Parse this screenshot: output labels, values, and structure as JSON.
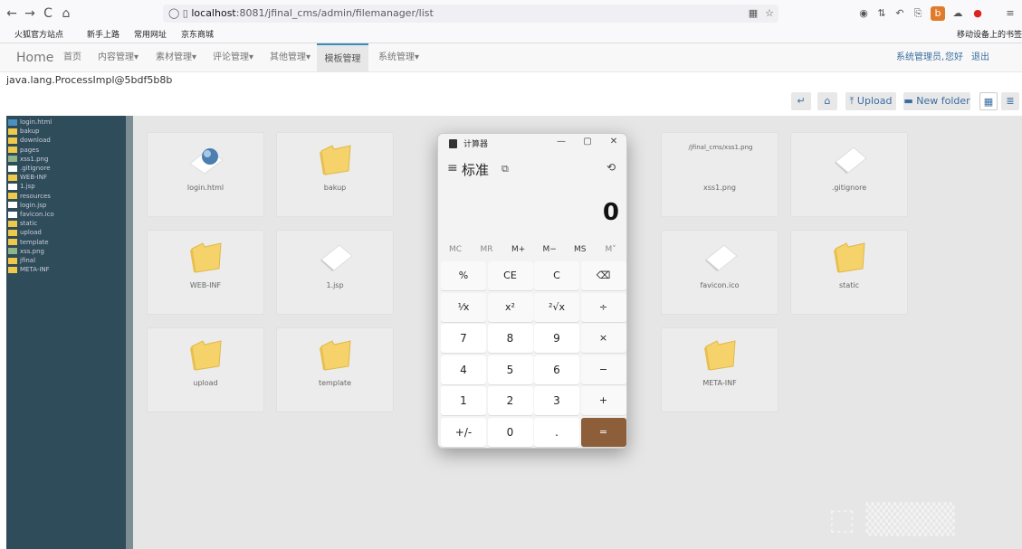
{
  "browser": {
    "back": "←",
    "forward": "→",
    "reload": "C",
    "home": "⌂",
    "url_host": "localhost",
    "url_rest": ":8081/jfinal_cms/admin/filemanager/list",
    "mobile_bookmarks": "移动设备上的书签"
  },
  "bookmarks": [
    "火狐官方站点",
    "新手上路",
    "常用网址",
    "京东商城"
  ],
  "nav": {
    "brand": "Home",
    "items": [
      "首页",
      "内容管理▾",
      "素材管理▾",
      "评论管理▾",
      "其他管理▾",
      "模板管理",
      "系统管理▾"
    ],
    "user": "系统管理员,",
    "greeting": "您好",
    "logout": "退出"
  },
  "process_text": "java.lang.ProcessImpl@5bdf5b8b",
  "toolbar": {
    "upload": "Upload",
    "new_folder": "New folder"
  },
  "tree": [
    "login.html",
    "bakup",
    "download",
    "pages",
    "xss1.png",
    ".gitignore",
    "WEB-INF",
    "1.jsp",
    "resources",
    "login.jsp",
    "favicon.ico",
    "static",
    "upload",
    "template",
    "xss.png",
    "jfinal",
    "META-INF"
  ],
  "tiles": [
    {
      "label": "login.html",
      "kind": "globe"
    },
    {
      "label": "bakup",
      "kind": "folder"
    },
    {
      "label": "xss1.png",
      "kind": "image",
      "caption": "/jfinal_cms/xss1.png"
    },
    {
      "label": ".gitignore",
      "kind": "file"
    },
    {
      "label": "WEB-INF",
      "kind": "folder"
    },
    {
      "label": "1.jsp",
      "kind": "file"
    },
    {
      "label": "favicon.ico",
      "kind": "file"
    },
    {
      "label": "static",
      "kind": "folder"
    },
    {
      "label": "upload",
      "kind": "folder"
    },
    {
      "label": "template",
      "kind": "folder"
    },
    {
      "label": "META-INF",
      "kind": "folder"
    }
  ],
  "calculator": {
    "title": "计算器",
    "mode": "标准",
    "display": "0",
    "memory": [
      "MC",
      "MR",
      "M+",
      "M−",
      "MS",
      "M˅"
    ],
    "keys": [
      "%",
      "CE",
      "C",
      "⌫",
      "¹⁄x",
      "x²",
      "²√x",
      "÷",
      "7",
      "8",
      "9",
      "×",
      "4",
      "5",
      "6",
      "−",
      "1",
      "2",
      "3",
      "+",
      "+/-",
      "0",
      ".",
      "="
    ]
  },
  "colors": {
    "sidebar": "#2e4c59",
    "equals": "#8d5e3a",
    "link": "#3a6da0"
  }
}
